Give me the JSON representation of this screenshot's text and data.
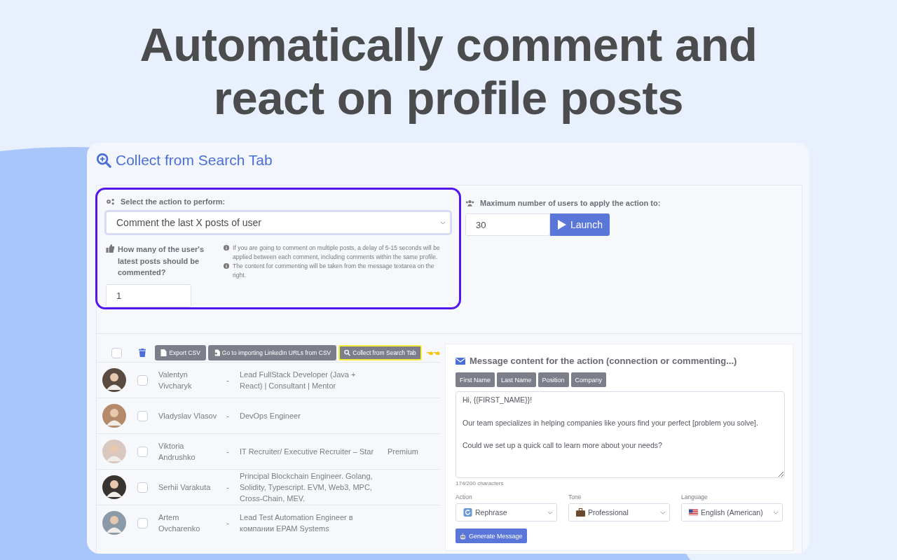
{
  "headline": "Automatically comment and react on profile posts",
  "panel": {
    "title": "Collect from Search Tab",
    "action_label": "Select the action to perform:",
    "action_select": {
      "value": "Comment the last X posts of user"
    },
    "posts_label": "How many of the user's latest posts should be commented?",
    "posts_input": {
      "value": "1"
    },
    "notes": [
      "If you are going to comment on multiple posts, a delay of 5-15 seconds will be applied between each comment, including comments within the same profile.",
      "The content for commenting will be taken from the message textarea on the right."
    ],
    "max_label": "Maximum number of users to apply the action to:",
    "max_input": {
      "value": "30"
    },
    "launch_button": "Launch"
  },
  "list": {
    "select_all": {
      "checked": false
    },
    "toolbar": [
      {
        "label": "Export CSV",
        "kind": "file",
        "highlighted": false
      },
      {
        "label": "Go to importing LinkedIn URLs from CSV",
        "kind": "import",
        "highlighted": false
      },
      {
        "label": "Collect from Search Tab",
        "kind": "search",
        "highlighted": true
      }
    ],
    "rows": [
      {
        "name": "Valentyn Vivcharyk",
        "separator": "-",
        "headline": "Lead FullStack Developer (Java + React) | Consultant | Mentor",
        "checked": false
      },
      {
        "name": "Vladyslav Vlasov",
        "separator": "-",
        "headline": "DevOps Engineer",
        "checked": false
      },
      {
        "name": "Viktoria Andrushko",
        "separator": "-",
        "headline": "IT Recruiter/ Executive Recruiter – Star",
        "badge": "Premium",
        "checked": false
      },
      {
        "name": "Serhii Varakuta",
        "separator": "-",
        "headline": "Principal Blockchain Engineer. Golang, Solidity, Typescript. EVM, Web3, MPC, Cross-Chain, MEV.",
        "checked": false
      },
      {
        "name": "Artem Ovcharenko",
        "separator": "-",
        "headline": "Lead Test Automation Engineer в компании EPAM Systems",
        "checked": false
      }
    ]
  },
  "message": {
    "title": "Message content for the action (connection or commenting...)",
    "variables": [
      "First Name",
      "Last Name",
      "Position",
      "Company"
    ],
    "text": "Hi, {{FIRST_NAME}}!\n\nOur team specializes in helping companies like yours find your perfect [problem you solve].\n\nCould we set up a quick call to learn more about your needs?",
    "counter": "174/200 characters",
    "options": [
      {
        "label": "Action",
        "value": "Rephrase",
        "kind": "refresh"
      },
      {
        "label": "Tone",
        "value": "Professional",
        "kind": "briefcase"
      },
      {
        "label": "Language",
        "value": "English (American)",
        "kind": "flag"
      }
    ],
    "generate_button": "Generate Message"
  }
}
